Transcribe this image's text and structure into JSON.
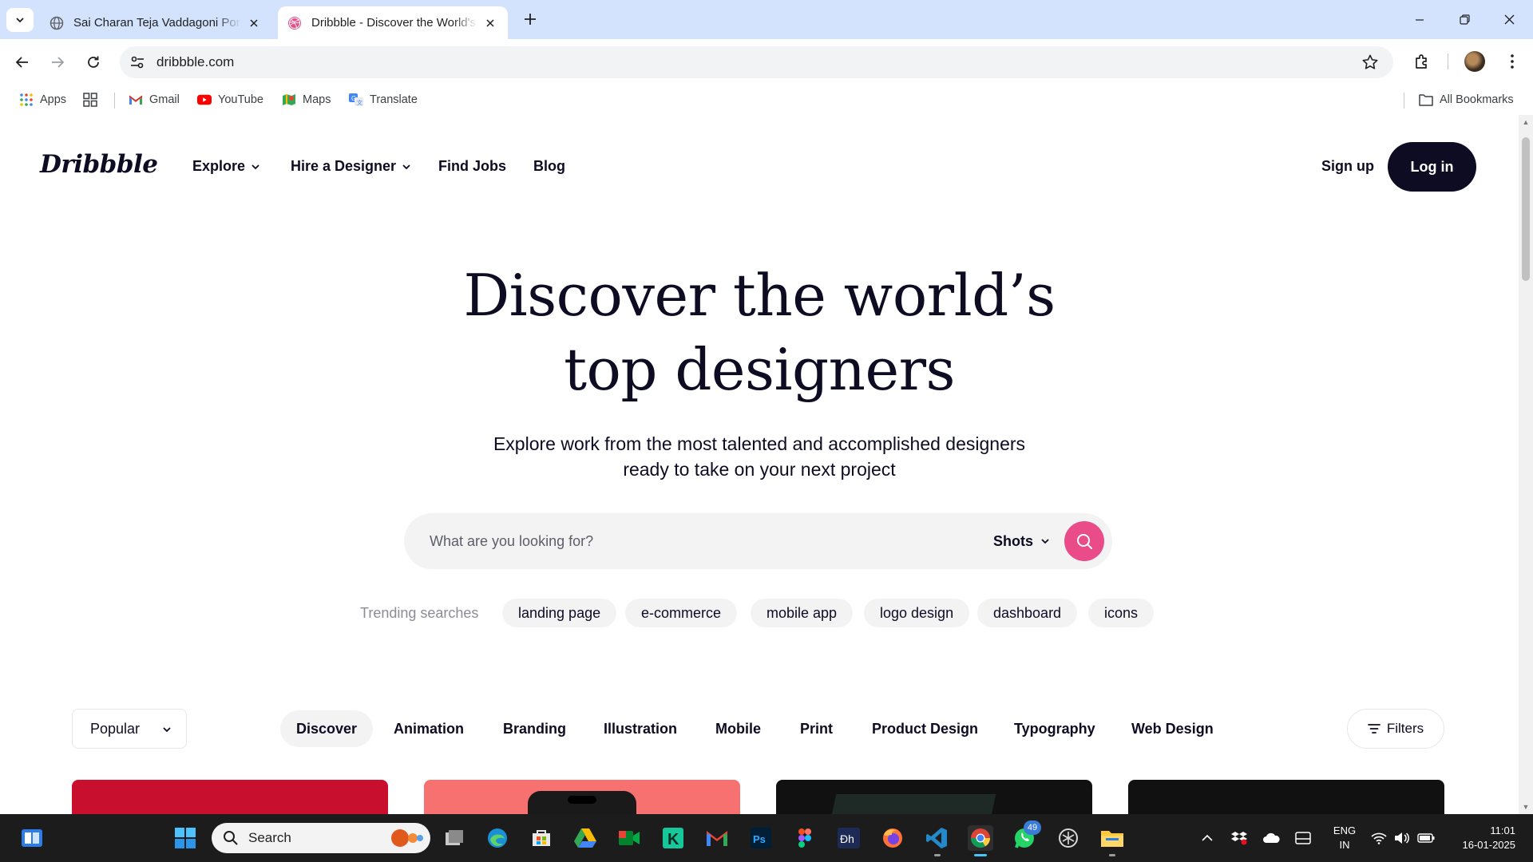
{
  "browser": {
    "tabs": [
      {
        "title": "Sai Charan Teja Vaddagoni Portfolio",
        "active": false
      },
      {
        "title": "Dribbble - Discover the World's Top Designers",
        "active": true
      }
    ],
    "url": "dribbble.com",
    "bookmarks": [
      {
        "label": "Apps",
        "icon": "apps-grid-icon"
      },
      {
        "label": "Gmail",
        "icon": "gmail-icon"
      },
      {
        "label": "YouTube",
        "icon": "youtube-icon"
      },
      {
        "label": "Maps",
        "icon": "maps-icon"
      },
      {
        "label": "Translate",
        "icon": "translate-icon"
      }
    ],
    "all_bookmarks": "All Bookmarks"
  },
  "site": {
    "logo": "Dribbble",
    "nav": [
      {
        "label": "Explore",
        "has_menu": true
      },
      {
        "label": "Hire a Designer",
        "has_menu": true
      },
      {
        "label": "Find Jobs",
        "has_menu": false
      },
      {
        "label": "Blog",
        "has_menu": false
      }
    ],
    "signup": "Sign up",
    "login": "Log in",
    "hero": {
      "title_line1": "Discover the world’s",
      "title_line2": "top designers",
      "subtitle_line1": "Explore work from the most talented and accomplished designers",
      "subtitle_line2": "ready to take on your next project"
    },
    "search": {
      "placeholder": "What are you looking for?",
      "scope": "Shots"
    },
    "trending": {
      "label": "Trending searches",
      "items": [
        "landing page",
        "e-commerce",
        "mobile app",
        "logo design",
        "dashboard",
        "icons"
      ]
    },
    "sort": "Popular",
    "categories": [
      "Discover",
      "Animation",
      "Branding",
      "Illustration",
      "Mobile",
      "Print",
      "Product Design",
      "Typography",
      "Web Design"
    ],
    "active_category": "Discover",
    "filters": "Filters",
    "card_colors": [
      "#c8102e",
      "#f87171",
      "#111111",
      "#111111"
    ]
  },
  "taskbar": {
    "search": "Search",
    "whatsapp_badge": "49",
    "lang_line1": "ENG",
    "lang_line2": "IN",
    "time": "11:01",
    "date": "16-01-2025"
  },
  "colors": {
    "accent_pink": "#ea4c89",
    "ink": "#0d0c22",
    "chrome_blue": "#d3e3fd"
  }
}
